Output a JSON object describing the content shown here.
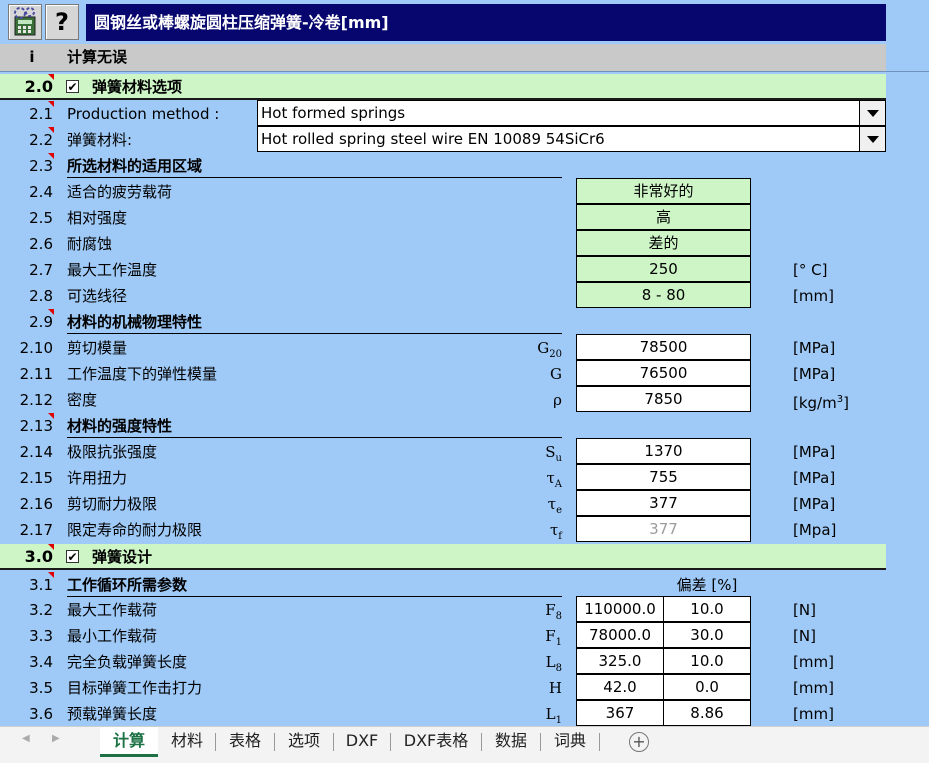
{
  "title": "圆钢丝或棒螺旋圆柱压缩弹簧-冷卷[mm]",
  "toolbar": {
    "calc_icon": "calculator-icon",
    "help_label": "?"
  },
  "status": {
    "col": "i",
    "text": "计算无误"
  },
  "sec2": {
    "num": "2.0",
    "check": "✔",
    "label": "弹簧材料选项"
  },
  "production": {
    "num": "2.1",
    "label": "Production method :",
    "value": "Hot formed springs"
  },
  "material": {
    "num": "2.2",
    "label": "弹簧材料:",
    "value": "Hot rolled spring steel wire EN 10089 54SiCr6"
  },
  "area": {
    "num": "2.3",
    "label": "所选材料的适用区域",
    "rows": [
      {
        "num": "2.4",
        "label": "适合的疲劳载荷",
        "value": "非常好的",
        "unit": ""
      },
      {
        "num": "2.5",
        "label": "相对强度",
        "value": "高",
        "unit": ""
      },
      {
        "num": "2.6",
        "label": "耐腐蚀",
        "value": "差的",
        "unit": ""
      },
      {
        "num": "2.7",
        "label": "最大工作温度",
        "value": "250",
        "unit": "[° C]"
      },
      {
        "num": "2.8",
        "label": "可选线径",
        "value": "8 - 80",
        "unit": "[mm]"
      }
    ]
  },
  "mech": {
    "num": "2.9",
    "label": "材料的机械物理特性",
    "rows": [
      {
        "num": "2.10",
        "label": "剪切模量",
        "sym": "G",
        "sub": "20",
        "value": "78500",
        "unit": "[MPa]"
      },
      {
        "num": "2.11",
        "label": "工作温度下的弹性模量",
        "sym": "G",
        "sub": "",
        "value": "76500",
        "unit": "[MPa]"
      },
      {
        "num": "2.12",
        "label": "密度",
        "sym": "ρ",
        "sub": "",
        "value": "7850",
        "unit": "[kg/m",
        "unit_sup": "3",
        "unit_end": "]"
      }
    ]
  },
  "strength": {
    "num": "2.13",
    "label": "材料的强度特性",
    "rows": [
      {
        "num": "2.14",
        "label": "极限抗张强度",
        "sym": "S",
        "sub": "u",
        "value": "1370",
        "unit": "[MPa]"
      },
      {
        "num": "2.15",
        "label": "许用扭力",
        "sym": "τ",
        "sub": "A",
        "value": "755",
        "unit": "[MPa]"
      },
      {
        "num": "2.16",
        "label": "剪切耐力极限",
        "sym": "τ",
        "sub": "e",
        "value": "377",
        "unit": "[MPa]"
      },
      {
        "num": "2.17",
        "label": "限定寿命的耐力极限",
        "sym": "τ",
        "sub": "f",
        "value": "377",
        "unit": "[Mpa]"
      }
    ]
  },
  "sec3": {
    "num": "3.0",
    "check": "✔",
    "label": "弹簧设计"
  },
  "cycle": {
    "num": "3.1",
    "label": "工作循环所需参数",
    "dev_label": "偏差 [%]",
    "rows": [
      {
        "num": "3.2",
        "label": "最大工作载荷",
        "sym": "F",
        "sub": "8",
        "value": "110000.0",
        "dev": "10.0",
        "unit": "[N]"
      },
      {
        "num": "3.3",
        "label": "最小工作载荷",
        "sym": "F",
        "sub": "1",
        "value": "78000.0",
        "dev": "30.0",
        "unit": "[N]"
      },
      {
        "num": "3.4",
        "label": "完全负载弹簧长度",
        "sym": "L",
        "sub": "8",
        "value": "325.0",
        "dev": "10.0",
        "unit": "[mm]"
      },
      {
        "num": "3.5",
        "label": "目标弹簧工作击打力",
        "sym": "H",
        "sub": "",
        "value": "42.0",
        "dev": "0.0",
        "unit": "[mm]"
      },
      {
        "num": "3.6",
        "label": "预载弹簧长度",
        "sym": "L",
        "sub": "1",
        "value": "367",
        "dev": "8.86",
        "unit": "[mm]"
      }
    ]
  },
  "tabs": [
    "计算",
    "材料",
    "表格",
    "选项",
    "DXF",
    "DXF表格",
    "数据",
    "词典"
  ],
  "tab_nav": {
    "prev": "◀",
    "next": "▶",
    "add": "+"
  },
  "colors": {
    "title_bg": "#06066e",
    "sheet_bg": "#9fcaf7",
    "section_bg": "#cdf5c6",
    "active_tab": "#1e7145",
    "comment_marker": "#e00000"
  }
}
